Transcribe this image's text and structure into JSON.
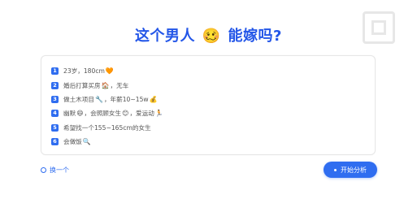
{
  "header": {
    "title_before": "这个男人",
    "title_emoji": "🥴",
    "title_after": "能嫁吗?"
  },
  "card": {
    "items": [
      {
        "num": "1",
        "text": "23岁，180cm",
        "icon": "🧡"
      },
      {
        "num": "2",
        "text": "婚后打算买房",
        "icon": "🏠",
        "text_after": "，无车"
      },
      {
        "num": "3",
        "text": "做土木项目",
        "icon": "🔧",
        "text_after": "，年薪10~15w",
        "icon2": "💰"
      },
      {
        "num": "4",
        "text": "幽默",
        "icon": "😄",
        "text_after": "，会照顾女生",
        "icon2": "😊",
        "text_after2": "，爱运动",
        "icon3": "🏃"
      },
      {
        "num": "5",
        "text": "希望找一个155~165cm的女生"
      },
      {
        "num": "6",
        "text": "会做饭",
        "icon": "🔍"
      }
    ]
  },
  "footer": {
    "refresh_label": "换一个",
    "start_label": "开始分析"
  }
}
